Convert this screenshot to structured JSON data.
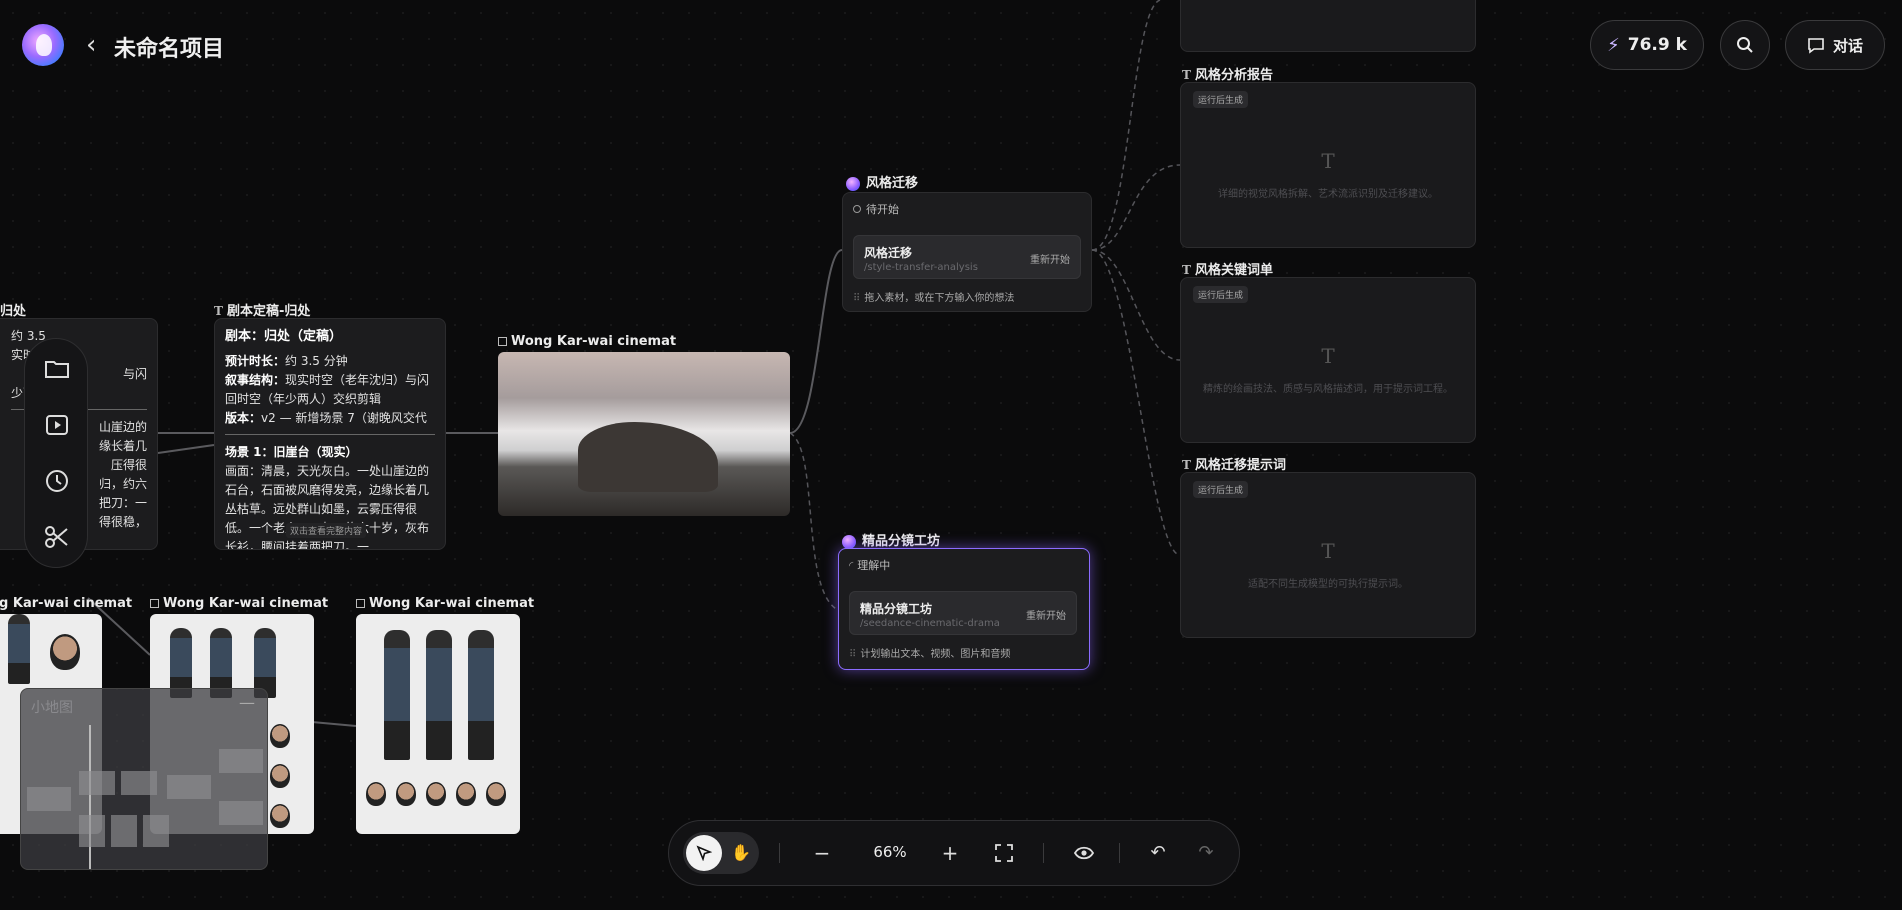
{
  "header": {
    "back_icon": "chevron-left-icon",
    "title": "未命名项目",
    "credits": "76.9 k",
    "chat_label": "对话"
  },
  "left_cut_node": {
    "title": "归处",
    "lines": [
      "约 3.5",
      "实时",
      "与闪",
      "少两人",
      "山崖边的",
      "缘长着几",
      "压得很",
      "归，约六",
      "把刀：一",
      "得很稳，"
    ]
  },
  "script_node": {
    "title": "剧本定稿-归处",
    "heading": "剧本：归处（定稿）",
    "duration_label": "预计时长：",
    "duration_value": "约 3.5 分钟",
    "structure_label": "叙事结构：",
    "structure_value": "现实时空（老年沈归）与闪回时空（年少两人）交织剪辑",
    "version_label": "版本：",
    "version_value": "v2 — 新增场景 7（谢晚风交代",
    "scene_heading": "场景 1：旧崖台（现实）",
    "scene_text": "画面：清晨，天光灰白。一处山崖边的石台，石面被风磨得发亮，边缘长着几丛枯草。远处群山如墨，云雾压得很低。一个老人……归，约六十岁，灰布长衫，腰间挂着两把刀。一",
    "tooltip": "双击查看完整内容"
  },
  "image_nodes": {
    "wkw_main": "Wong Kar-wai cinemat",
    "wkw_left": "Wong Kar-wai cinemat",
    "wkw_mid": "Wong Kar-wai cinemat",
    "wkw_right": "Wong Kar-wai cinemat"
  },
  "style_transfer": {
    "title": "风格迁移",
    "status": "待开始",
    "skill_name": "风格迁移",
    "skill_path": "/style-transfer-analysis",
    "restart": "重新开始",
    "hint": "拖入素材，或在下方输入你的想法"
  },
  "storyboard": {
    "title": "精品分镜工坊",
    "status": "理解中",
    "skill_name": "精品分镜工坊",
    "skill_path": "/seedance-cinematic-drama",
    "restart": "重新开始",
    "hint": "计划输出文本、视频、图片和音频"
  },
  "outputs": [
    {
      "title": "风格分析报告",
      "tag": "运行后生成",
      "desc": "详细的视觉风格拆解、艺术流派识别及迁移建议。"
    },
    {
      "title": "风格关键词单",
      "tag": "运行后生成",
      "desc": "精炼的绘画技法、质感与风格描述词，用于提示词工程。"
    },
    {
      "title": "风格迁移提示词",
      "tag": "运行后生成",
      "desc": "适配不同生成模型的可执行提示词。"
    }
  ],
  "sidebar": {
    "icons": [
      "folder-icon",
      "video-icon",
      "history-icon",
      "scissors-icon"
    ]
  },
  "minimap": {
    "title": "小地图"
  },
  "bottom_toolbar": {
    "zoom": "66%"
  }
}
